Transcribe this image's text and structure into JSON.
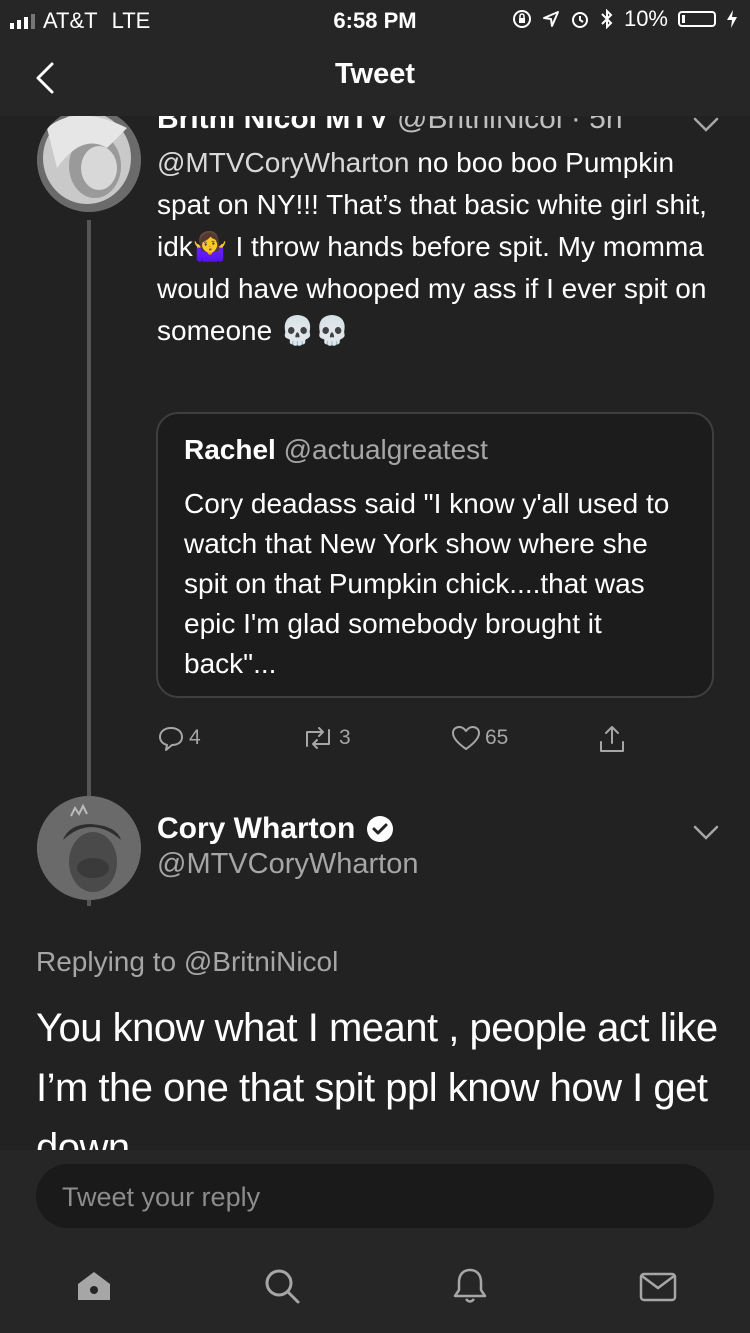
{
  "status_bar": {
    "carrier": "AT&T",
    "network": "LTE",
    "time": "6:58 PM",
    "battery": "10%",
    "battery_level": 0.1
  },
  "nav": {
    "title": "Tweet"
  },
  "parent_tweet": {
    "name": "Britni Nicol MTV",
    "handle": "@BritniNicol",
    "age": "5h",
    "text_mention": "@MTVCoryWharton",
    "text_line1": " no boo boo Pumpkin spat on NY!!! That’s that basic white girl shit, idk",
    "text_line2": " I throw hands before spit. My momma would have whooped my ass if I ever spit on someone ",
    "emoji_shrug": "🤷‍♀️",
    "emoji_skulls": "💀💀",
    "quote": {
      "name": "Rachel",
      "handle": "@actualgreatest",
      "text": "Cory deadass said \"I know y'all used to watch that New York show where she spit on that Pumpkin chick....that was epic I'm glad somebody brought it back\"..."
    },
    "actions": {
      "replies": "4",
      "retweets": "3",
      "likes": "65"
    }
  },
  "main_tweet": {
    "name": "Cory Wharton",
    "handle": "@MTVCoryWharton",
    "replying_prefix": "Replying to ",
    "replying_to": "@BritniNicol",
    "text": "You know what I meant , people act like I’m the one that spit ppl know how I get down"
  },
  "reply": {
    "placeholder": "Tweet your reply"
  },
  "icons": {
    "home": "home-icon",
    "search": "search-icon",
    "notifications": "bell-icon",
    "messages": "mail-icon"
  }
}
